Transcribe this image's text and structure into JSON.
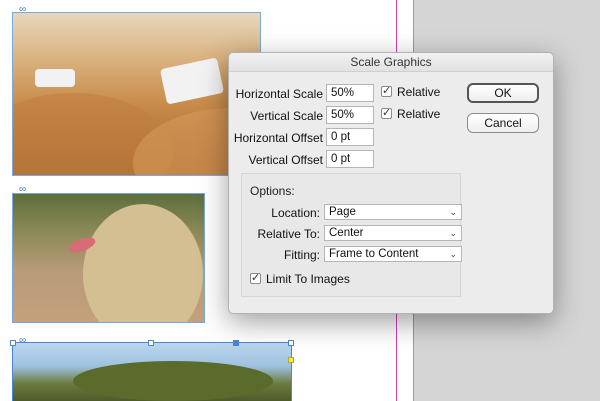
{
  "dialog": {
    "title": "Scale Graphics",
    "horizontal_scale": {
      "label": "Horizontal Scale",
      "value": "50%",
      "relative_label": "Relative",
      "relative_checked": true
    },
    "vertical_scale": {
      "label": "Vertical Scale",
      "value": "50%",
      "relative_label": "Relative",
      "relative_checked": true
    },
    "horizontal_offset": {
      "label": "Horizontal Offset",
      "value": "0 pt"
    },
    "vertical_offset": {
      "label": "Vertical Offset",
      "value": "0 pt"
    },
    "ok_label": "OK",
    "cancel_label": "Cancel",
    "options": {
      "heading": "Options:",
      "location": {
        "label": "Location:",
        "value": "Page"
      },
      "relative_to": {
        "label": "Relative To:",
        "value": "Center"
      },
      "fitting": {
        "label": "Fitting:",
        "value": "Frame to Content"
      },
      "limit_to_images": {
        "label": "Limit To Images",
        "checked": true
      }
    }
  },
  "canvas": {
    "image_frames": [
      "desert-safari-image",
      "lioness-image",
      "acacia-tree-image"
    ]
  },
  "icons": {
    "link": "link-icon",
    "checkbox_checked": "checkmark-icon",
    "dropdown": "chevron-down-icon"
  }
}
